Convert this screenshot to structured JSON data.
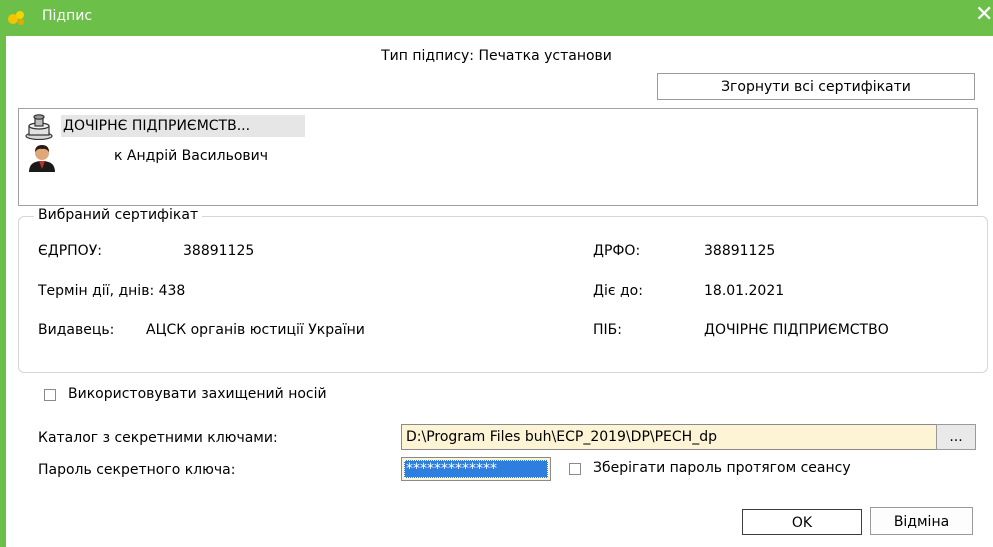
{
  "window": {
    "title": "Підпис",
    "close_glyph": "✕",
    "title_bar_color": "#6cc04a"
  },
  "signature_type": "Тип підпису: Печатка установи",
  "collapse_button": "Згорнути всі сертифікати",
  "cert_tree": {
    "items": [
      {
        "icon": "seal-stamp-icon",
        "label": "ДОЧІРНЄ ПІДПРИЄМСТВ..."
      },
      {
        "icon": "person-icon",
        "label": "к Андрій Васильович"
      }
    ]
  },
  "selected_cert": {
    "group_title": "Вибраний сертифікат",
    "edrpou_label": "ЄДРПОУ:",
    "edrpou_value": "38891125",
    "drfo_label": "ДРФО:",
    "drfo_value": "38891125",
    "validity_days_label": "Термін дії, днів: 438",
    "valid_until_label": "Діє до:",
    "valid_until_value": "18.01.2021",
    "issuer_label": "Видавець:",
    "issuer_value": "АЦСК органів юстиції України",
    "name_label": "ПІБ:",
    "name_value": "ДОЧІРНЄ ПІДПРИЄМСТВО"
  },
  "use_secure_media": {
    "label": "Використовувати захищений носій",
    "checked": false
  },
  "keys_dir": {
    "label": "Каталог з секретними ключами:",
    "value": "D:\\Program Files buh\\ECP_2019\\DP\\PECH_dp",
    "browse_label": "..."
  },
  "password": {
    "label": "Пароль секретного ключа:",
    "masked_value": "*************"
  },
  "save_password": {
    "label": "Зберігати пароль протягом сеансу",
    "checked": false
  },
  "buttons": {
    "ok": "OK",
    "cancel": "Відміна"
  },
  "colors": {
    "field_bg": "#fcf4d4",
    "selection": "#2e7ee0"
  }
}
